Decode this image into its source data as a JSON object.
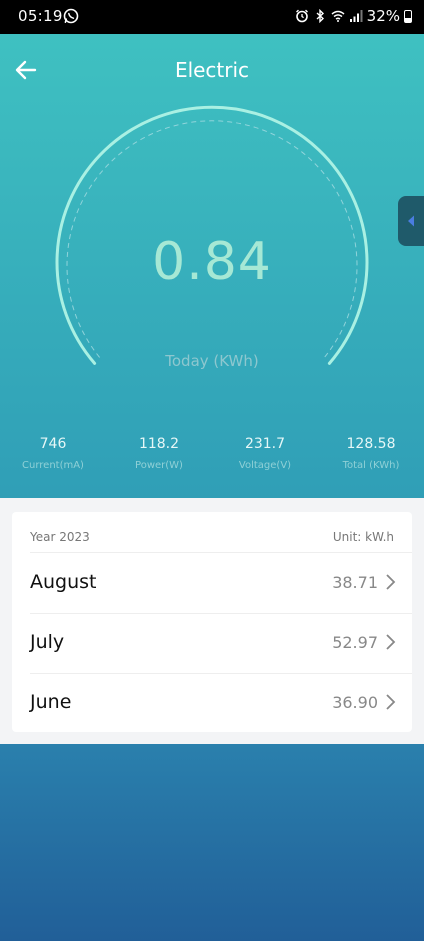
{
  "status_bar": {
    "time": "05:19",
    "battery": "32%"
  },
  "header": {
    "title": "Electric"
  },
  "gauge": {
    "value": "0.84",
    "label": "Today (KWh)"
  },
  "stats": [
    {
      "value": "746",
      "label": "Current(mA)"
    },
    {
      "value": "118.2",
      "label": "Power(W)"
    },
    {
      "value": "231.7",
      "label": "Voltage(V)"
    },
    {
      "value": "128.58",
      "label": "Total (KWh)"
    }
  ],
  "history": {
    "year": "Year 2023",
    "unit": "Unit: kW.h",
    "rows": [
      {
        "month": "August",
        "value": "38.71"
      },
      {
        "month": "July",
        "value": "52.97"
      },
      {
        "month": "June",
        "value": "36.90"
      }
    ]
  },
  "colors": {
    "gradient_top": "#40c3c2",
    "gradient_bottom": "#2a8db0",
    "gauge_value": "#a6e8d5",
    "side_tab": "#1f5a6a",
    "side_tab_arrow": "#4a7de0"
  }
}
